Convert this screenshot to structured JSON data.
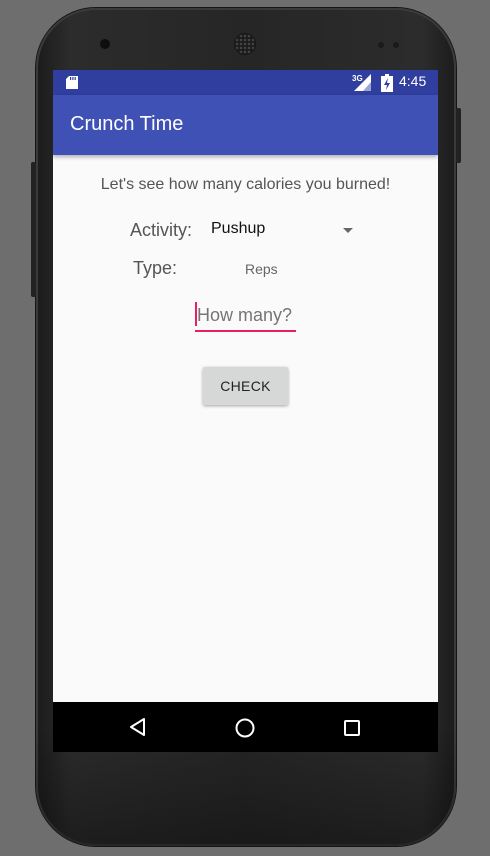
{
  "status_bar": {
    "time": "4:45",
    "network": "3G",
    "icons": [
      "sd-card-icon",
      "signal-icon",
      "battery-icon"
    ]
  },
  "app_bar": {
    "title": "Crunch Time"
  },
  "main": {
    "intro_text": "Let's see how many calories you burned!",
    "activity_label": "Activity:",
    "activity_selected": "Pushup",
    "type_label": "Type:",
    "type_value": "Reps",
    "quantity_placeholder": "How many?",
    "quantity_value": "",
    "check_label": "CHECK"
  },
  "nav_bar": {
    "icons": [
      "back-icon",
      "home-icon",
      "recents-icon"
    ]
  },
  "colors": {
    "status_bar": "#303f9f",
    "app_bar": "#3f51b5",
    "accent": "#e91e63",
    "background": "#fafafa"
  }
}
